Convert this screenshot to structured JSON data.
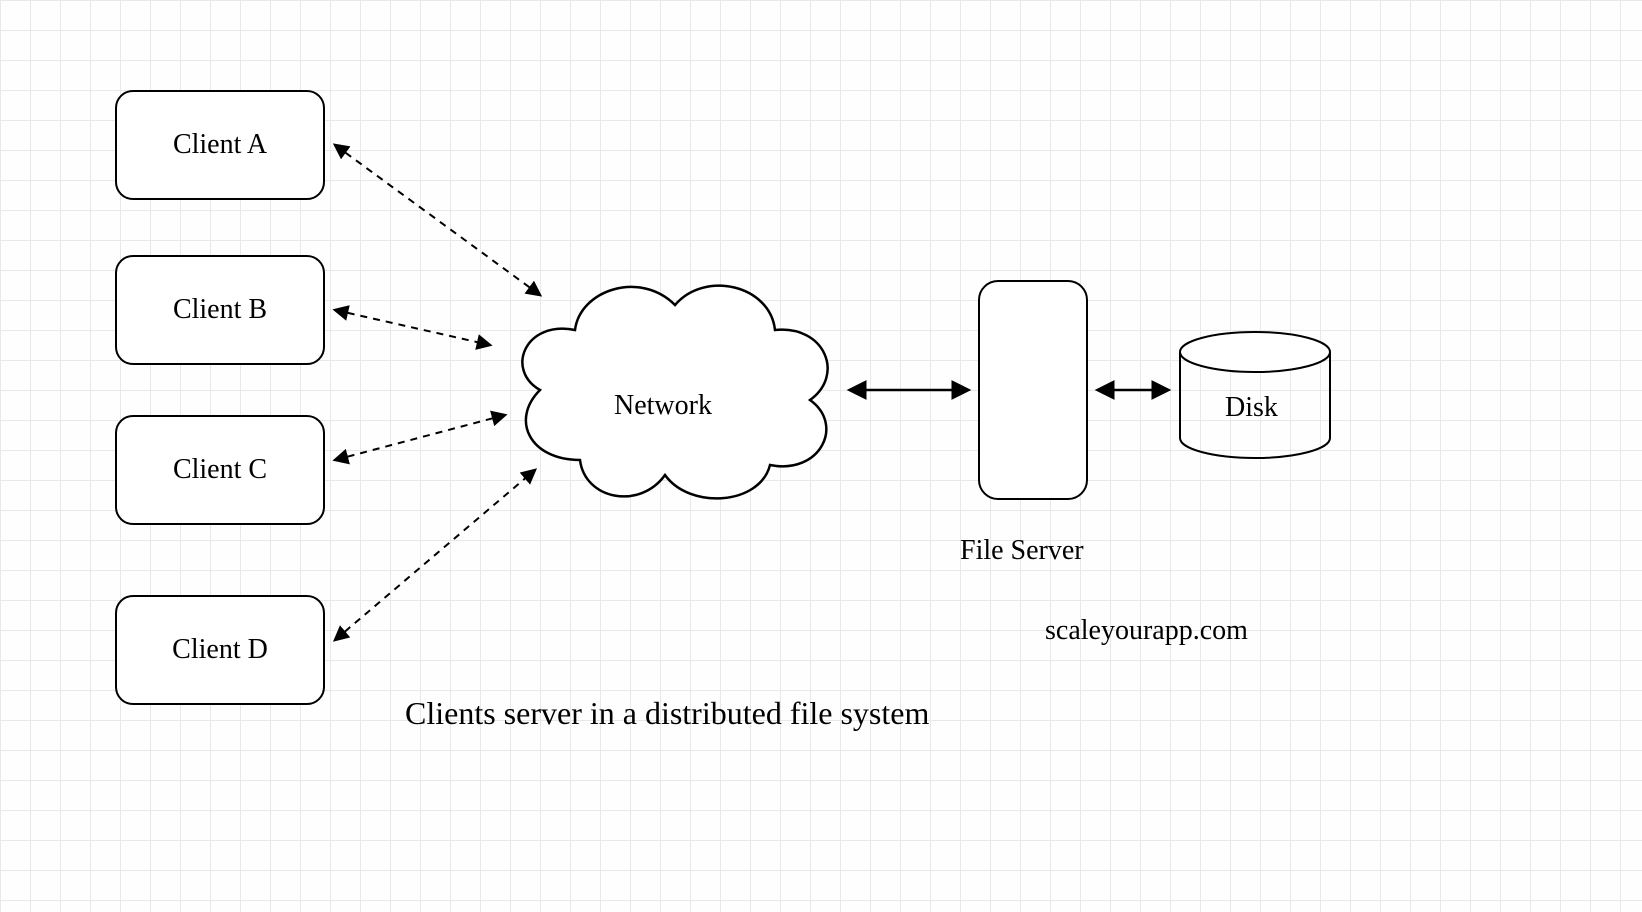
{
  "clients": [
    {
      "label": "Client A"
    },
    {
      "label": "Client B"
    },
    {
      "label": "Client C"
    },
    {
      "label": "Client D"
    }
  ],
  "network": {
    "label": "Network"
  },
  "server": {
    "label": "File Server"
  },
  "disk": {
    "label": "Disk"
  },
  "caption": "Clients server in a distributed file system",
  "watermark": "scaleyourapp.com"
}
